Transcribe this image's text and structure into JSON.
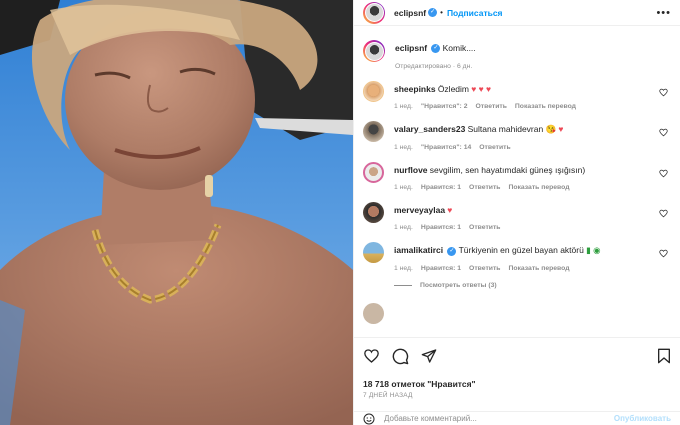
{
  "post": {
    "username": "eclipsnf",
    "follow_label": "Подписаться",
    "dot": "•",
    "more": "•••",
    "caption": "Komik....",
    "edited_meta": "Отредактировано · 6 дн."
  },
  "comments": [
    {
      "user": "sheepinks",
      "text": "Özledim",
      "emoji": "♥ ♥ ♥",
      "time": "1 нед.",
      "likes": "\"Нравится\": 2",
      "reply": "Ответить",
      "translate": "Показать перевод"
    },
    {
      "user": "valary_sanders23",
      "text": "Sultana mahidevran",
      "emoji": "😘 ♥",
      "time": "1 нед.",
      "likes": "\"Нравится\": 14",
      "reply": "Ответить"
    },
    {
      "user": "nurflove",
      "text": "sevgilim, sen hayatımdaki güneş ışığısın)",
      "time": "1 нед.",
      "likes": "Нравится: 1",
      "reply": "Ответить",
      "translate": "Показать перевод"
    },
    {
      "user": "merveyaylaa",
      "emoji": "♥",
      "time": "1 нед.",
      "likes": "Нравится: 1",
      "reply": "Ответить"
    },
    {
      "user": "iamalikatirci",
      "text": "Türkiyenin en güzel bayan aktörü",
      "emoji": "▮ ◉",
      "time": "1 нед.",
      "likes": "Нравится: 1",
      "reply": "Ответить",
      "translate": "Показать перевод",
      "view_replies": "Посмотреть ответы (3)"
    }
  ],
  "likes_text": "18 718 отметок \"Нравится\"",
  "date_text": "7 ДНЕЙ НАЗАД",
  "add_comment": {
    "placeholder": "Добавьте комментарий...",
    "post_label": "Опубликовать"
  },
  "colors": {
    "accent": "#0095f6",
    "heart": "#ed4956",
    "muted": "#8e8e8e"
  },
  "icons": [
    "heart-icon",
    "comment-icon",
    "share-icon",
    "bookmark-icon",
    "emoji-icon",
    "more-icon"
  ]
}
